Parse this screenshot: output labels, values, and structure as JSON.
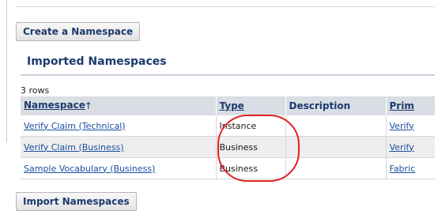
{
  "buttons": {
    "create_namespace": "Create a Namespace",
    "import_namespaces": "Import Namespaces"
  },
  "section": {
    "title": "Imported Namespaces",
    "row_count": "3 rows"
  },
  "table": {
    "columns": {
      "namespace": "Namespace",
      "namespace_sort_icon": "sort-ascending-arrow",
      "type": "Type",
      "description": "Description",
      "primary": "Prim"
    },
    "rows": [
      {
        "namespace": "Verify Claim (Technical)",
        "type": "Instance",
        "description": "",
        "primary": "Verify"
      },
      {
        "namespace": "Verify Claim (Business)",
        "type": "Business",
        "description": "",
        "primary": "Verify"
      },
      {
        "namespace": "Sample Vocabulary (Business)",
        "type": "Business",
        "description": "",
        "primary": "Fabric"
      }
    ]
  },
  "colors": {
    "accent_text": "#1c3a6e",
    "link": "#1c4fa0",
    "header_bg": "#d9dee4",
    "highlight_ring": "#e02020"
  }
}
